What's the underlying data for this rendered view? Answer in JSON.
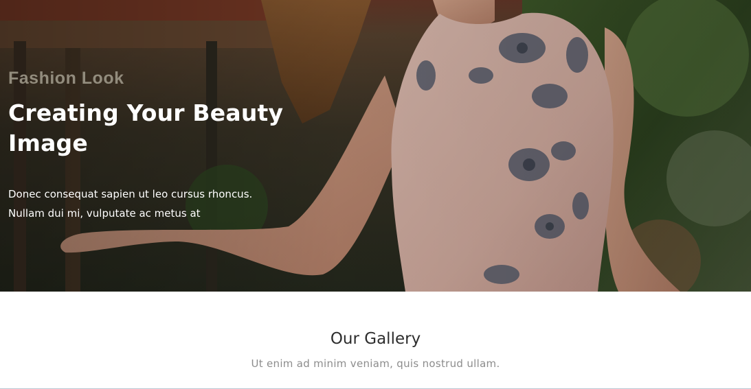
{
  "hero": {
    "kicker": "Fashion Look",
    "title": "Creating Your Beauty Image",
    "description": "Donec consequat sapien ut leo cursus rhoncus. Nullam dui mi, vulputate ac metus at"
  },
  "gallery": {
    "title": "Our Gallery",
    "subtitle": "Ut enim ad minim veniam, quis nostrud ullam."
  },
  "colors": {
    "hero_text": "#ffffff",
    "kicker": "#9d9788",
    "heading": "#2d2d2d",
    "muted": "#8c8c8c"
  }
}
